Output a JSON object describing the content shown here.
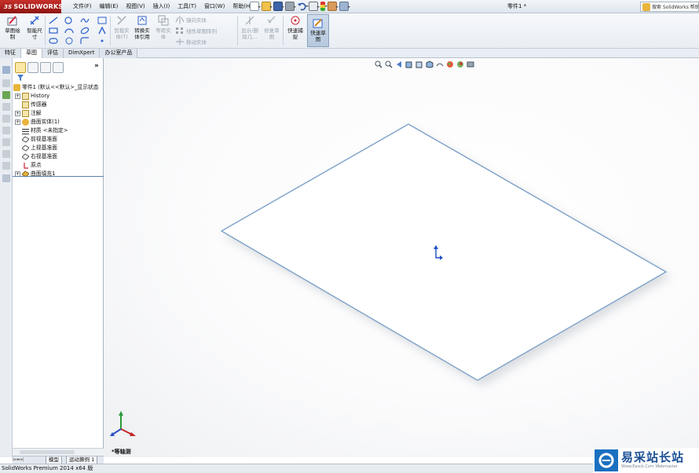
{
  "app": {
    "logo_text": "SOLIDWORKS",
    "logo_prefix": "3S"
  },
  "menu": {
    "items": [
      "文件(F)",
      "编辑(E)",
      "视图(V)",
      "插入(I)",
      "工具(T)",
      "窗口(W)",
      "帮助(H)"
    ]
  },
  "window": {
    "doc_title": "零件1 *"
  },
  "search": {
    "placeholder": "搜索 SolidWorks 帮助"
  },
  "ribbon": {
    "sketch": "草图绘\n制",
    "smart_dim": "智能尺\n寸",
    "trim": "剪裁实\n体(T)",
    "convert": "转换实\n体引用",
    "offset": "等距实\n体",
    "mirror": "镜向实体",
    "linear_pattern": "线性草图阵列",
    "move": "移动实体",
    "display_delete": "显示/删\n除几...",
    "repair": "修复草\n图",
    "quick_snaps": "快速捕\n捉",
    "quick_sketch": "快速草\n图"
  },
  "tabs": [
    "特征",
    "草图",
    "评估",
    "DimXpert",
    "办公室产品"
  ],
  "active_tab": 1,
  "tree": {
    "root": "零件1 (默认<<默认>_显示状态",
    "items": [
      {
        "label": "History",
        "expand": true
      },
      {
        "label": "传感器",
        "expand": false
      },
      {
        "label": "注解",
        "expand": true
      },
      {
        "label": "曲面实体(1)",
        "expand": true
      },
      {
        "label": "材质 <未指定>",
        "expand": false
      },
      {
        "label": "前视基准面",
        "expand": false
      },
      {
        "label": "上视基准面",
        "expand": false
      },
      {
        "label": "右视基准面",
        "expand": false
      },
      {
        "label": "原点",
        "expand": false
      },
      {
        "label": "曲面填充1",
        "expand": true
      }
    ]
  },
  "viewport": {
    "view_label": "*等轴测"
  },
  "bottom_tabs": [
    "模型",
    "运动算例 1"
  ],
  "status": {
    "text": "SolidWorks Premium 2014 x64 版"
  },
  "watermark": {
    "title": "易采站长站",
    "url": "Www.Easck.Com Webmaster"
  },
  "colors": {
    "accent_red": "#c6302a",
    "plane_edge": "#7ea2c8",
    "selection": "#2d62c8"
  }
}
